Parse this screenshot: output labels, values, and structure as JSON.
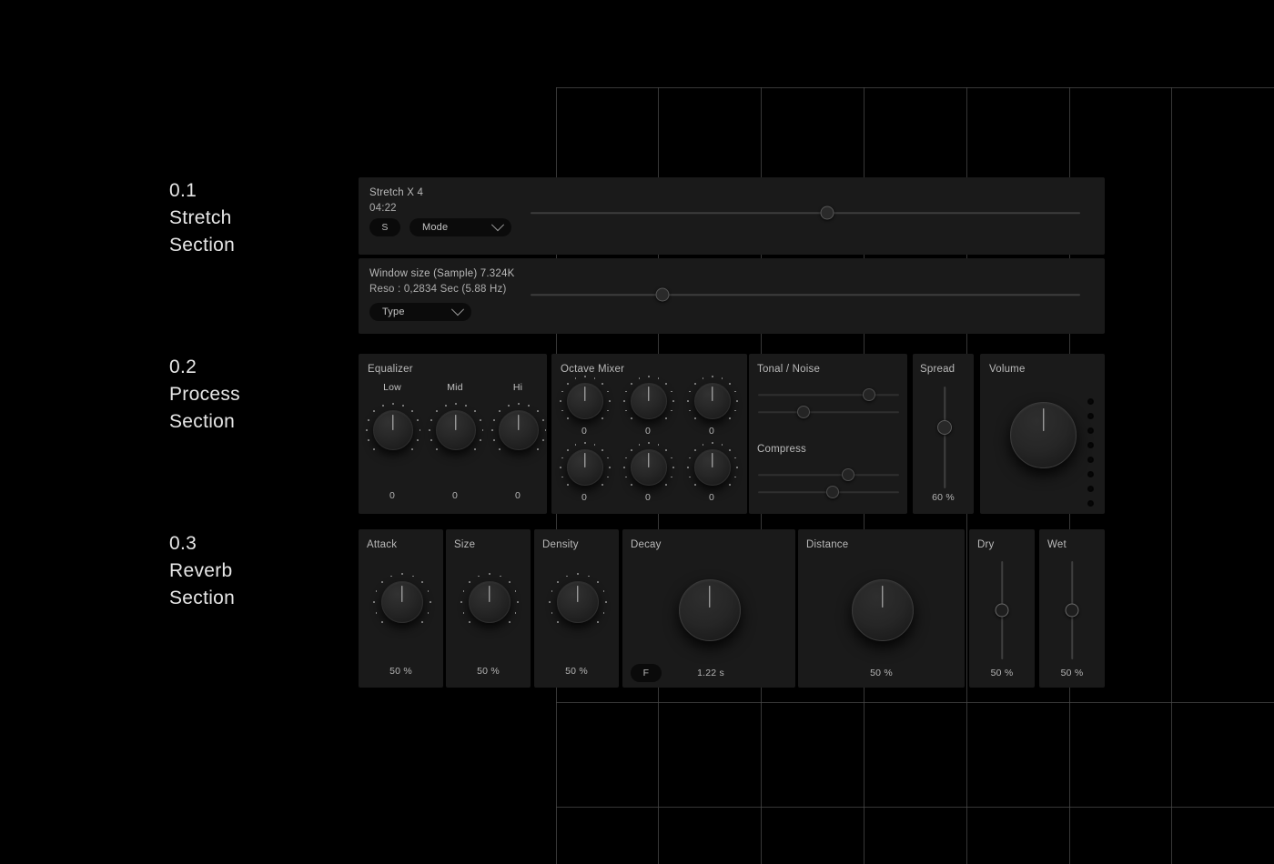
{
  "sections": [
    {
      "num": "0.1",
      "line1": "Stretch",
      "line2": "Section"
    },
    {
      "num": "0.2",
      "line1": "Process",
      "line2": "Section"
    },
    {
      "num": "0.3",
      "line1": "Reverb",
      "line2": "Section"
    }
  ],
  "stretch": {
    "title": "Stretch X 4",
    "time": "04:22",
    "solo_button": "S",
    "mode_dropdown": "Mode",
    "slider_percent": 54
  },
  "window": {
    "title": "Window size (Sample) 7.324K",
    "reso": "Reso : 0,2834 Sec (5.88 Hz)",
    "type_dropdown": "Type",
    "slider_percent": 24
  },
  "equalizer": {
    "title": "Equalizer",
    "knobs": [
      {
        "label": "Low",
        "value": "0"
      },
      {
        "label": "Mid",
        "value": "0"
      },
      {
        "label": "Hi",
        "value": "0"
      }
    ]
  },
  "octave_mixer": {
    "title": "Octave Mixer",
    "knobs": [
      {
        "value": "0"
      },
      {
        "value": "0"
      },
      {
        "value": "0"
      },
      {
        "value": "0"
      },
      {
        "value": "0"
      },
      {
        "value": "0"
      }
    ]
  },
  "tonal_noise": {
    "title": "Tonal / Noise",
    "sliders": [
      {
        "percent": 79
      },
      {
        "percent": 32
      }
    ]
  },
  "compress": {
    "title": "Compress",
    "sliders": [
      {
        "percent": 64
      },
      {
        "percent": 53
      }
    ]
  },
  "spread": {
    "title": "Spread",
    "value": "60 %",
    "percent": 60
  },
  "volume": {
    "title": "Volume",
    "led_count": 8
  },
  "reverb": {
    "attack": {
      "title": "Attack",
      "value": "50 %"
    },
    "size": {
      "title": "Size",
      "value": "50 %"
    },
    "density": {
      "title": "Density",
      "value": "50 %"
    },
    "decay": {
      "title": "Decay",
      "value": "1.22 s",
      "freeze_button": "F"
    },
    "distance": {
      "title": "Distance",
      "value": "50 %"
    },
    "dry": {
      "title": "Dry",
      "value": "50 %",
      "percent": 50
    },
    "wet": {
      "title": "Wet",
      "value": "50 %",
      "percent": 50
    }
  },
  "colors": {
    "background": "#000000",
    "panel": "#1a1a1a",
    "panel_alt": "#1c1c1c",
    "grid_line": "#4a4a4a",
    "text": "#c9c9c9",
    "pill": "#0a0a0a"
  }
}
